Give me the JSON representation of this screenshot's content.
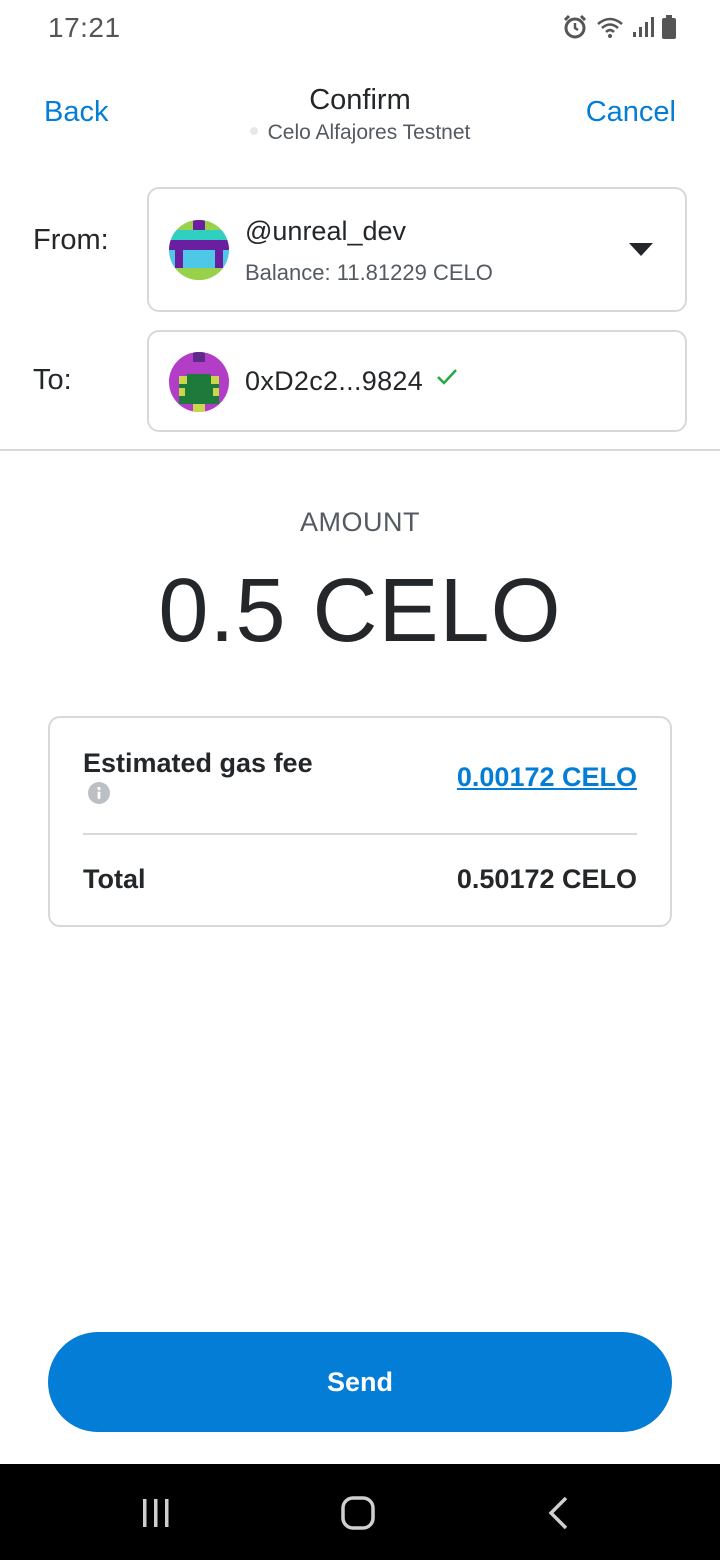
{
  "status_bar": {
    "time": "17:21",
    "icons": [
      "alarm-icon",
      "wifi-icon",
      "signal-icon",
      "battery-icon"
    ]
  },
  "header": {
    "back_label": "Back",
    "title": "Confirm",
    "network": "Celo Alfajores Testnet",
    "cancel_label": "Cancel"
  },
  "from": {
    "label": "From:",
    "account_name": "@unreal_dev",
    "balance": "Balance: 11.81229 CELO"
  },
  "to": {
    "label": "To:",
    "address": "0xD2c2...9824"
  },
  "amount": {
    "label": "AMOUNT",
    "value": "0.5 CELO"
  },
  "fees": {
    "gas_label": "Estimated gas fee",
    "gas_value": "0.00172 CELO",
    "total_label": "Total",
    "total_value": "0.50172 CELO"
  },
  "send_button_label": "Send",
  "colors": {
    "accent": "#037dd6",
    "text": "#24272a",
    "muted": "#535a61",
    "border": "#d6d9dc",
    "success": "#28a745"
  },
  "nav_bar": {
    "icons": [
      "recents-icon",
      "home-icon",
      "back-icon"
    ]
  }
}
